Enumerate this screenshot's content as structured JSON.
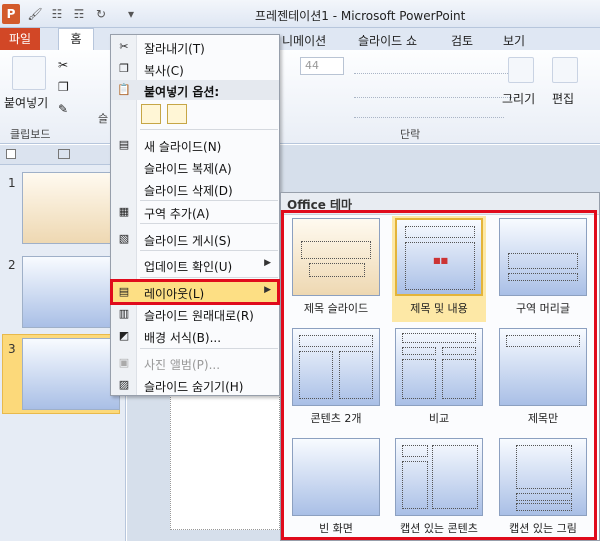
{
  "app": {
    "title": "프레젠테이션1 - Microsoft PowerPoint",
    "logo_letter": "P"
  },
  "ribbon": {
    "file_tab": "파일",
    "home_tab": "홈",
    "tabs": [
      "니메이션",
      "슬라이드 쇼",
      "검토",
      "보기"
    ],
    "font_size": "44",
    "paste_label": "붙여넣기",
    "clipboard_label": "클립보드",
    "slide_group_partial": "슬",
    "paragraph_label": "단락",
    "drawing_label": "그리기",
    "editing_label": "편집"
  },
  "slides": {
    "numbers": [
      "1",
      "2",
      "3"
    ]
  },
  "context_menu": {
    "items": [
      {
        "label": "잘라내기(T)",
        "icon": "scissors-icon"
      },
      {
        "label": "복사(C)",
        "icon": "copy-icon"
      },
      {
        "label": "붙여넣기 옵션:",
        "icon": "paste-icon"
      },
      {
        "label": "새 슬라이드(N)",
        "icon": "new-slide-icon"
      },
      {
        "label": "슬라이드 복제(A)",
        "icon": ""
      },
      {
        "label": "슬라이드 삭제(D)",
        "icon": ""
      },
      {
        "label": "구역 추가(A)",
        "icon": "section-icon"
      },
      {
        "label": "슬라이드 게시(S)",
        "icon": "publish-icon"
      },
      {
        "label": "업데이트 확인(U)",
        "icon": ""
      },
      {
        "label": "레이아웃(L)",
        "icon": "layout-icon"
      },
      {
        "label": "슬라이드 원래대로(R)",
        "icon": "reset-icon"
      },
      {
        "label": "배경 서식(B)...",
        "icon": "background-icon"
      },
      {
        "label": "사진 앨범(P)...",
        "icon": "photo-album-icon"
      },
      {
        "label": "슬라이드 숨기기(H)",
        "icon": "hide-slide-icon"
      }
    ]
  },
  "layout_gallery": {
    "title": "Office 테마",
    "layouts": [
      "제목 슬라이드",
      "제목 및 내용",
      "구역 머리글",
      "콘텐츠 2개",
      "비교",
      "제목만",
      "빈 화면",
      "캡션 있는 콘텐츠",
      "캡션 있는 그림"
    ],
    "selected_index": 1
  },
  "colors": {
    "highlight_red": "#e00b1c",
    "selected_fill": "#fddf84",
    "file_tab": "#d24726"
  }
}
